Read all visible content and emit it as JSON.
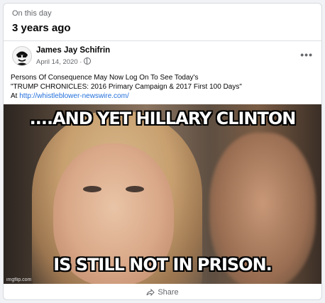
{
  "memory": {
    "label": "On this day",
    "heading": "3 years ago"
  },
  "post": {
    "author": "James Jay Schifrin",
    "date": "April 14, 2020 ·",
    "text_line1": "Persons Of Consequence May Now Log On To See Today's",
    "text_line2": "\"TRUMP CHRONICLES: 2016 Primary Campaign & 2017 First 100 Days\"",
    "text_at": "At ",
    "link": "http://whistleblower-newswire.com/"
  },
  "meme": {
    "top_text": "....AND YET HILLARY CLINTON",
    "bottom_text": "IS STILL NOT IN PRISON.",
    "watermark": "imgflip.com"
  },
  "actions": {
    "share": "Share"
  },
  "icons": {
    "more": "more-options-icon",
    "privacy": "globe-icon",
    "share": "share-arrow-icon"
  }
}
